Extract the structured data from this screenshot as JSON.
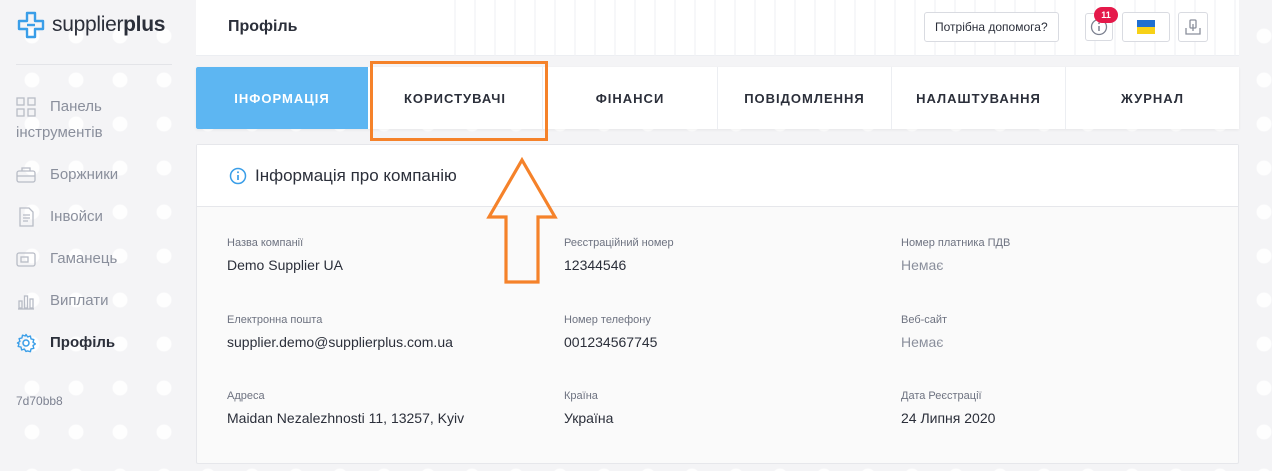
{
  "brand": {
    "name_light": "supplier",
    "name_bold": "plus"
  },
  "sidebar": {
    "items": [
      {
        "label": "Панель інструментів",
        "icon": "dashboard-icon"
      },
      {
        "label": "Боржники",
        "icon": "debtors-icon"
      },
      {
        "label": "Інвойси",
        "icon": "invoice-icon"
      },
      {
        "label": "Гаманець",
        "icon": "wallet-icon"
      },
      {
        "label": "Виплати",
        "icon": "payouts-icon"
      },
      {
        "label": "Профіль",
        "icon": "gear-icon",
        "active": true
      }
    ],
    "version": "7d70bb8"
  },
  "header": {
    "title": "Профіль",
    "help_label": "Потрібна допомога?",
    "notification_count": "11"
  },
  "tabs": [
    {
      "label": "ІНФОРМАЦІЯ",
      "active": true
    },
    {
      "label": "КОРИСТУВАЧІ"
    },
    {
      "label": "ФІНАНСИ"
    },
    {
      "label": "ПОВІДОМЛЕННЯ"
    },
    {
      "label": "НАЛАШТУВАННЯ"
    },
    {
      "label": "ЖУРНАЛ"
    }
  ],
  "company_info": {
    "title": "Інформація про компанію",
    "fields": [
      {
        "label": "Назва компанії",
        "value": "Demo Supplier UA"
      },
      {
        "label": "Реєстраційний номер",
        "value": "12344546"
      },
      {
        "label": "Номер платника ПДВ",
        "value": "Немає",
        "muted": true
      },
      {
        "label": "Електронна пошта",
        "value": "supplier.demo@supplierplus.com.ua"
      },
      {
        "label": "Номер телефону",
        "value": "001234567745"
      },
      {
        "label": "Веб-сайт",
        "value": "Немає",
        "muted": true
      },
      {
        "label": "Адреса",
        "value": "Maidan Nezalezhnosti 11, 13257, Kyiv"
      },
      {
        "label": "Країна",
        "value": "Україна"
      },
      {
        "label": "Дата Реєстрації",
        "value": "24 Липня 2020"
      }
    ]
  },
  "colors": {
    "accent": "#5db6f2",
    "highlight": "#f5822a",
    "badge": "#e5194a",
    "brand_blue": "#3a9ee8"
  }
}
